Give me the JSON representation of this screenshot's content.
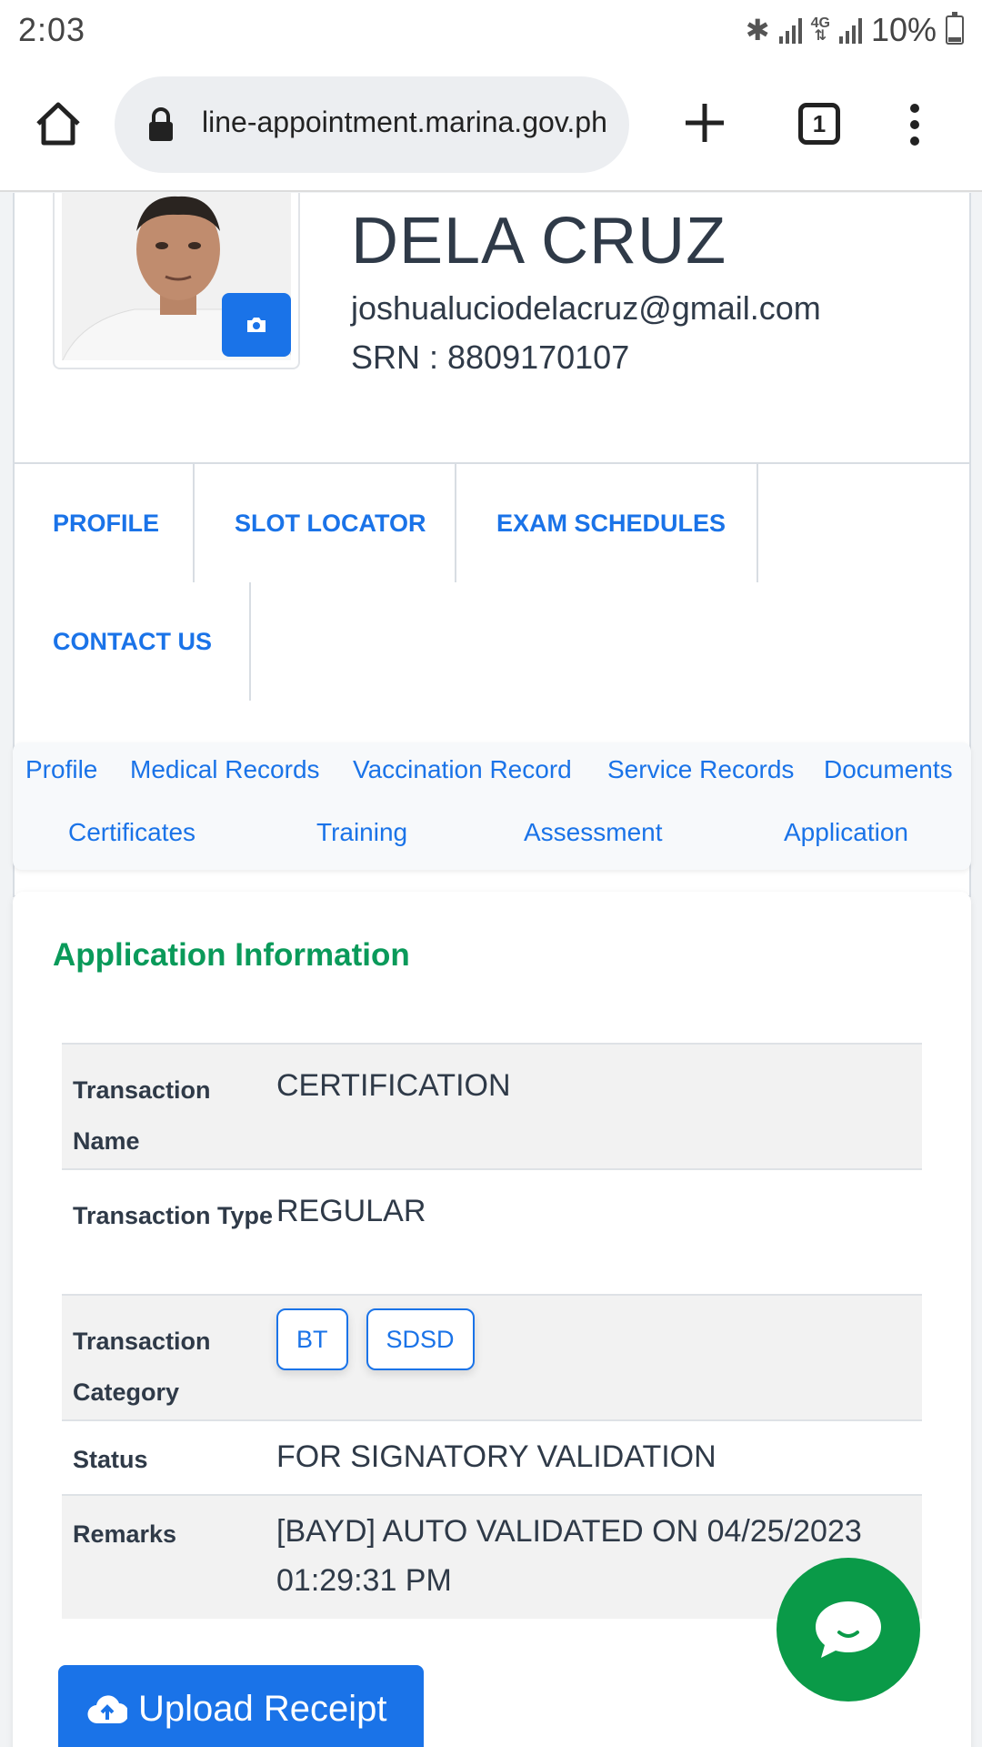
{
  "status_bar": {
    "time": "2:03",
    "battery": "10%",
    "network": "4G"
  },
  "browser": {
    "url": "line-appointment.marina.gov.ph",
    "tab_count": "1"
  },
  "profile": {
    "name": "DELA CRUZ",
    "email": "joshualuciodelacruz@gmail.com",
    "srn": "SRN : 8809170107"
  },
  "nav": {
    "items": [
      {
        "label": "PROFILE"
      },
      {
        "label": "SLOT LOCATOR"
      },
      {
        "label": "EXAM SCHEDULES"
      },
      {
        "label": "CONTACT US"
      }
    ]
  },
  "sub_tabs": [
    {
      "label": "Profile"
    },
    {
      "label": "Medical Records"
    },
    {
      "label": "Vaccination Record"
    },
    {
      "label": "Service Records"
    },
    {
      "label": "Documents"
    },
    {
      "label": "Certificates"
    },
    {
      "label": "Training"
    },
    {
      "label": "Assessment"
    },
    {
      "label": "Application"
    }
  ],
  "application": {
    "title": "Application Information",
    "rows": {
      "transaction_name": {
        "key": "Transaction Name",
        "value": "CERTIFICATION"
      },
      "transaction_type": {
        "key": "Transaction Type",
        "value": "REGULAR"
      },
      "transaction_category": {
        "key": "Transaction Category",
        "chips": [
          "BT",
          "SDSD"
        ]
      },
      "status": {
        "key": "Status",
        "value": "FOR SIGNATORY VALIDATION"
      },
      "remarks": {
        "key": "Remarks",
        "value": "[BAYD] AUTO VALIDATED ON 04/25/2023 01:29:31 PM"
      }
    },
    "upload_label": "Upload Receipt"
  },
  "colors": {
    "primary": "#1a73e8",
    "title_green": "#0a9a5a",
    "chat_green": "#0a9a48"
  }
}
